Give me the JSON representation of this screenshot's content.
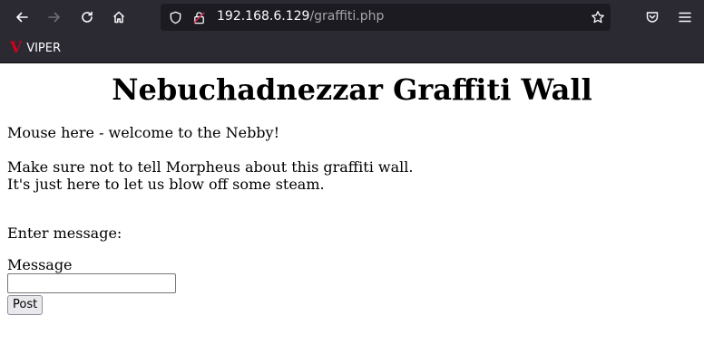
{
  "browser": {
    "url_host": "192.168.6.129",
    "url_path": "/graffiti.php",
    "bookmarks": [
      {
        "logo": "V",
        "label": "VIPER"
      }
    ],
    "icons": {
      "back": "arrow-left-icon",
      "forward": "arrow-right-icon",
      "reload": "reload-icon",
      "home": "home-icon",
      "tracking": "shield-icon",
      "security": "lock-icon",
      "bookmark_star": "star-icon",
      "pocket": "pocket-icon",
      "menu": "hamburger-menu-icon"
    }
  },
  "page": {
    "title": "Nebuchadnezzar Graffiti Wall",
    "paragraph1": "Mouse here - welcome to the Nebby!",
    "paragraph2_line1": "Make sure not to tell Morpheus about this graffiti wall.",
    "paragraph2_line2": "It's just here to let us blow off some steam.",
    "enter_message": "Enter message:",
    "form": {
      "label": "Message",
      "input_value": "",
      "button_label": "Post"
    }
  }
}
